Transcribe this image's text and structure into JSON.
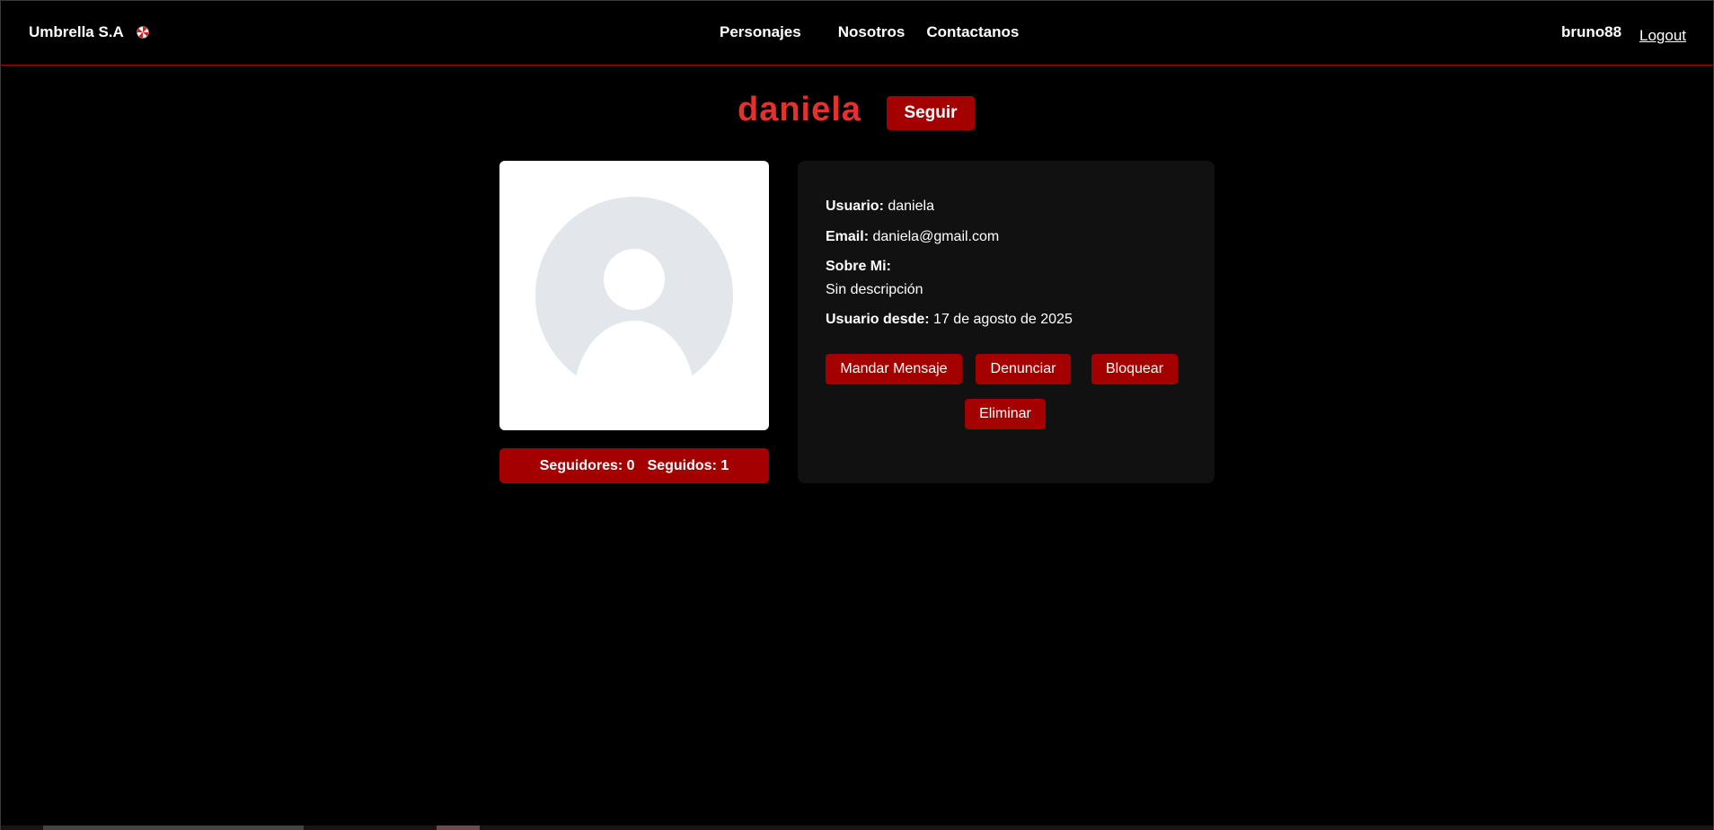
{
  "navbar": {
    "brand": "Umbrella S.A",
    "links": [
      "Personajes",
      "Nosotros",
      "Contactanos"
    ],
    "user": "bruno88",
    "logout": "Logout"
  },
  "profile": {
    "name": "daniela",
    "follow_label": "Seguir",
    "stats": {
      "followers_label": "Seguidores: 0",
      "following_label": "Seguidos: 1"
    },
    "info": {
      "user_label": "Usuario:",
      "user_value": "daniela",
      "email_label": "Email:",
      "email_value": "daniela@gmail.com",
      "about_label": "Sobre Mi:",
      "about_value": "Sin descripción",
      "since_label": "Usuario desde:",
      "since_value": "17 de agosto de 2025"
    },
    "actions": {
      "message": "Mandar Mensaje",
      "report": "Denunciar",
      "block": "Bloquear",
      "delete": "Eliminar"
    }
  },
  "colors": {
    "accent": "#a50000",
    "title": "#e3312e",
    "background": "#000000",
    "card": "#111111"
  }
}
